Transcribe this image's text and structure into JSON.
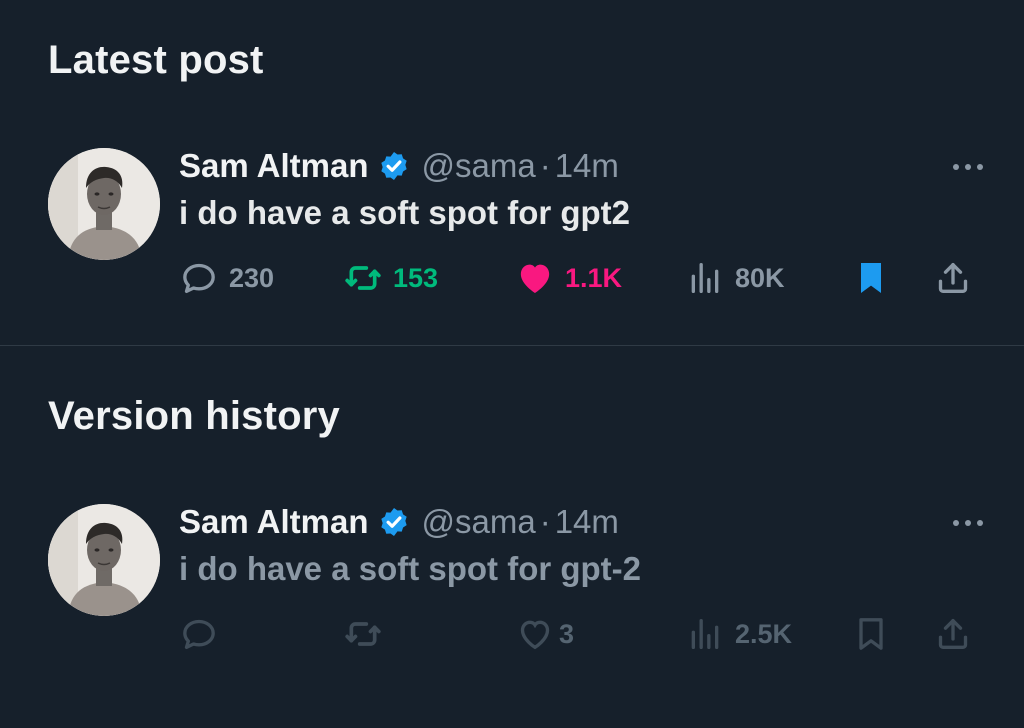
{
  "sections": {
    "latest_title": "Latest post",
    "history_title": "Version history"
  },
  "latest": {
    "author_name": "Sam Altman",
    "handle": "@sama",
    "separator": "·",
    "time": "14m",
    "text": "i do have a soft spot for gpt2",
    "replies": "230",
    "reposts": "153",
    "likes": "1.1K",
    "views": "80K",
    "liked": true,
    "reposted": true,
    "bookmarked": true
  },
  "history": {
    "author_name": "Sam Altman",
    "handle": "@sama",
    "separator": "·",
    "time": "14m",
    "text": "i do have a soft spot for gpt-2",
    "likes": "3",
    "views": "2.5K"
  },
  "icons": {
    "reply": "reply-icon",
    "repost": "repost-icon",
    "like": "heart-icon",
    "views": "views-icon",
    "bookmark": "bookmark-icon",
    "share": "share-icon",
    "verified": "verified-badge-icon",
    "more": "more-options-icon"
  },
  "colors": {
    "background": "#16202b",
    "text_primary": "#f1f3f4",
    "text_secondary": "#8b98a5",
    "verified_blue": "#1d9bf0",
    "repost_green": "#00ba7c",
    "like_pink": "#f91880",
    "bookmark_blue": "#1d9bf0",
    "dim_icon": "#3f4c58"
  }
}
